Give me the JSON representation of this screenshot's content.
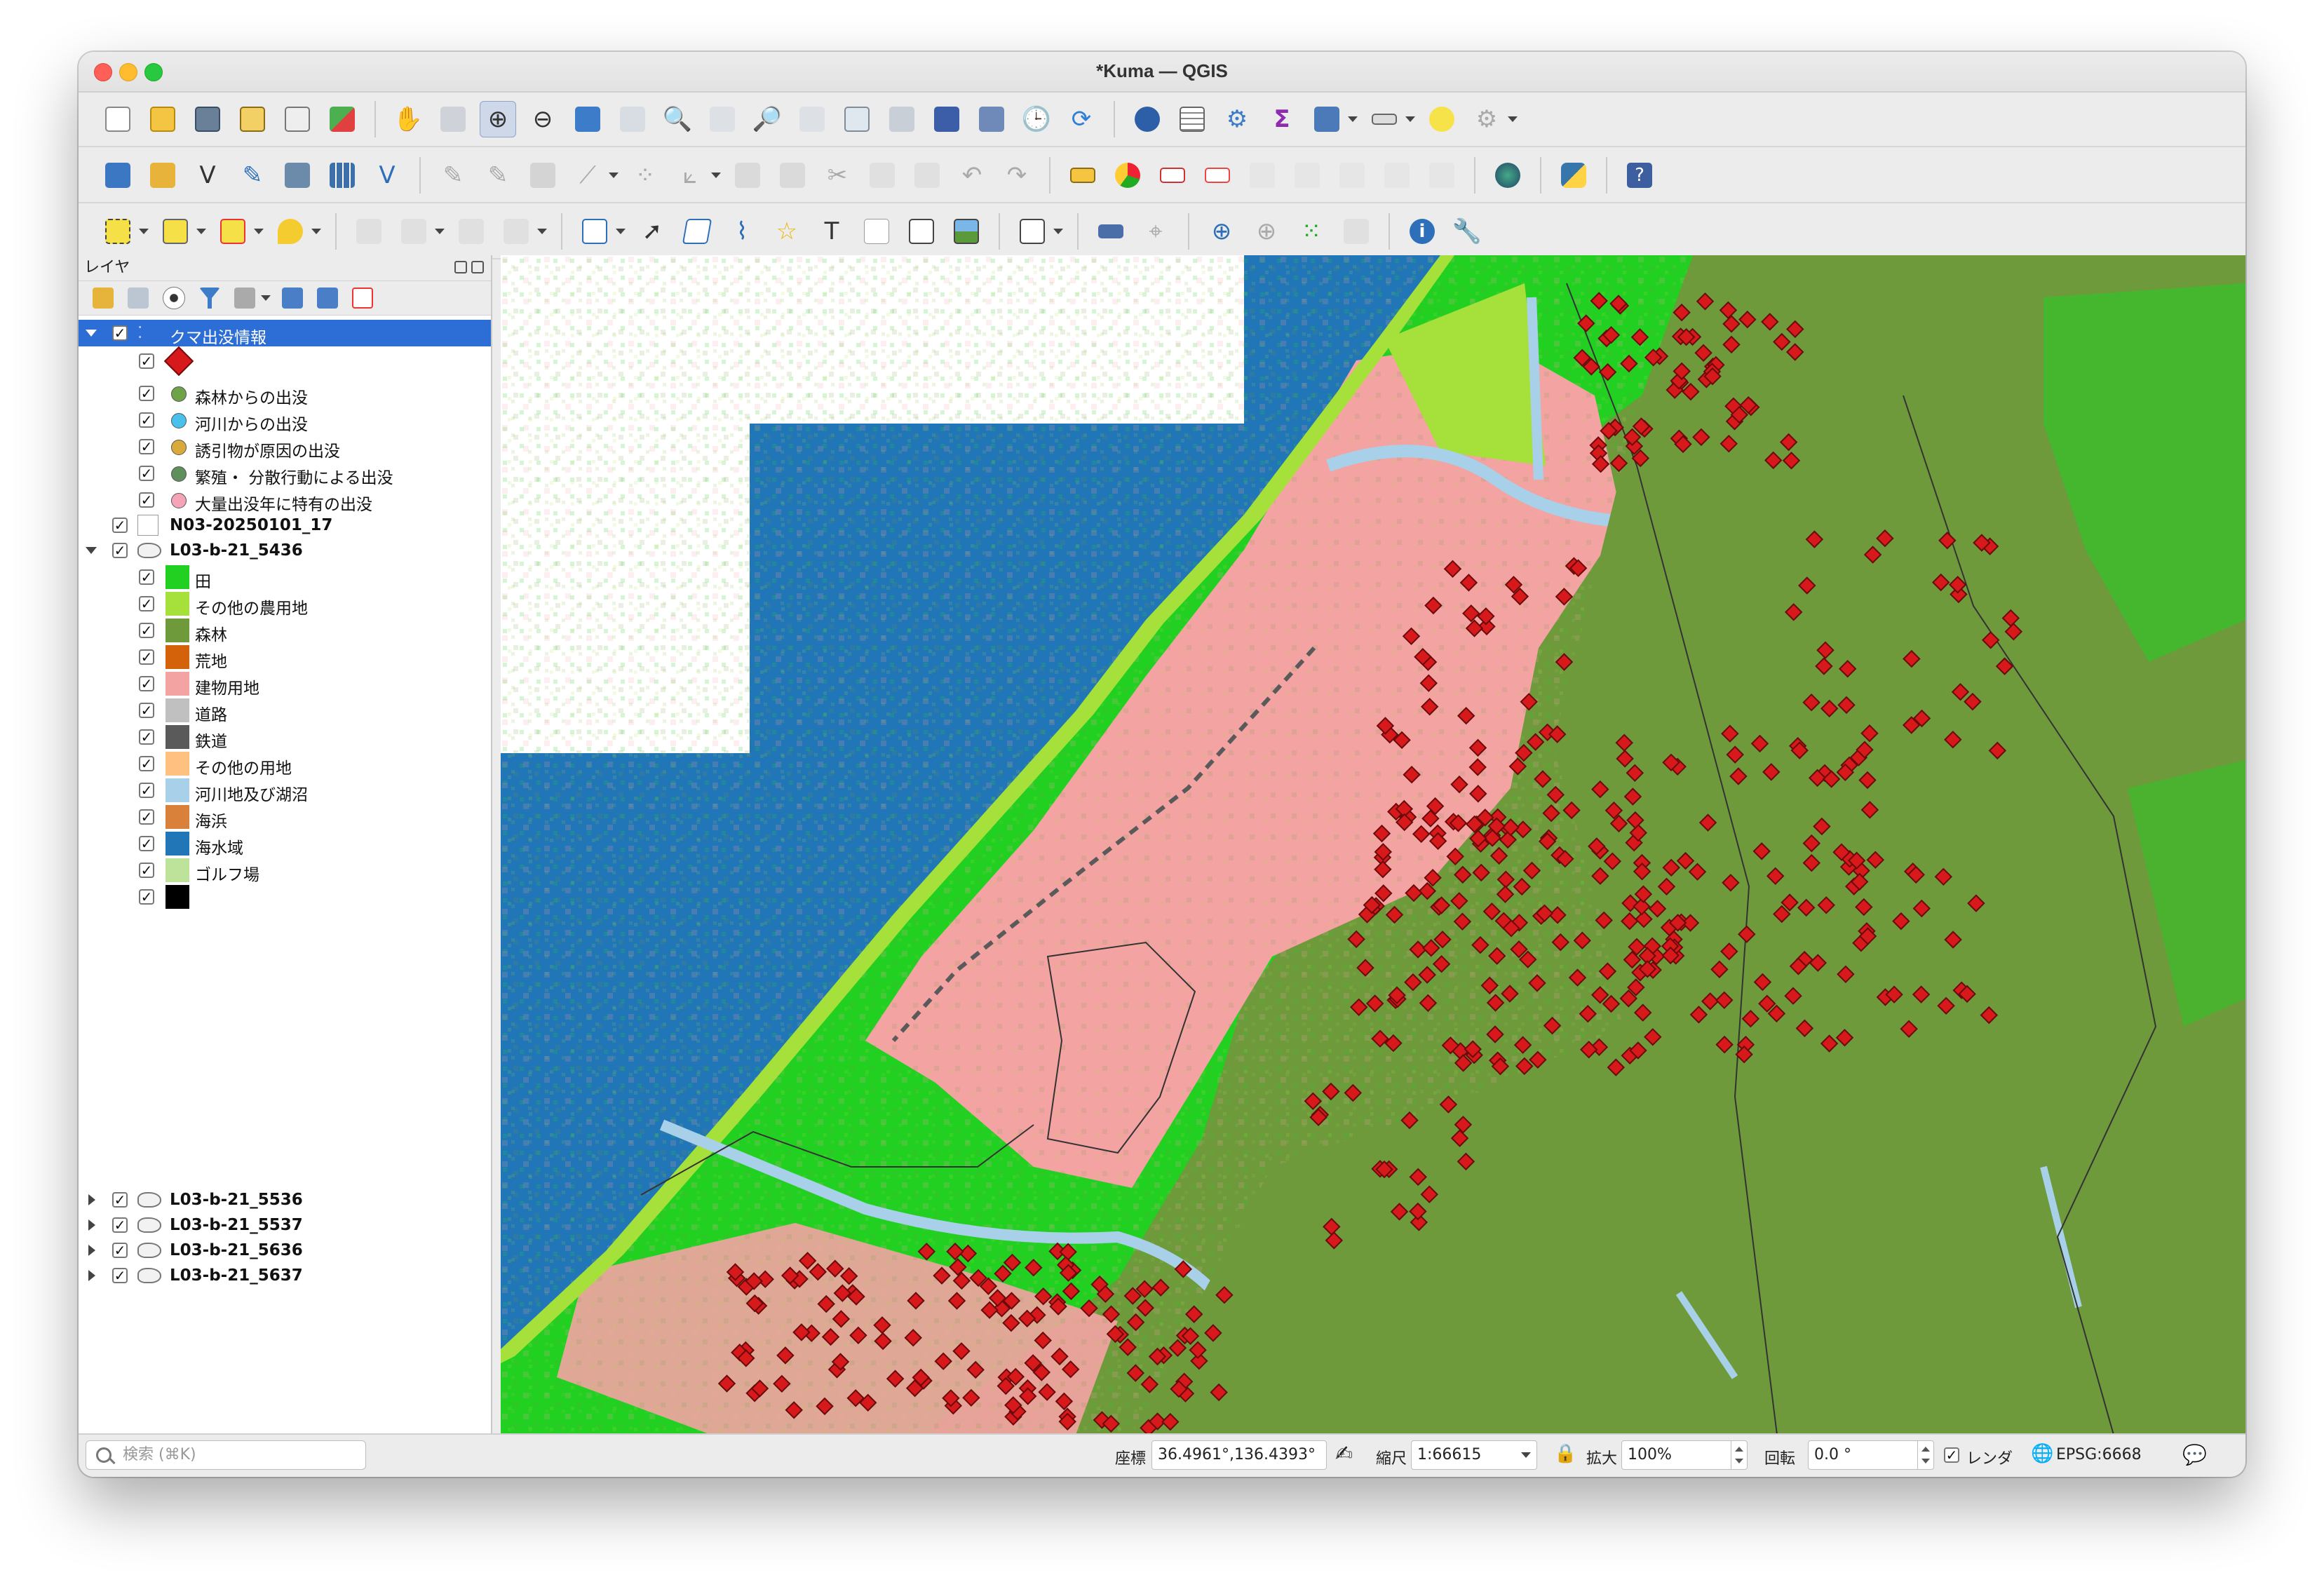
{
  "window": {
    "title": "*Kuma — QGIS"
  },
  "layer_panel": {
    "title": "レイヤ",
    "layers": [
      {
        "name": "クマ出没情報",
        "type": "point-group",
        "selected": true,
        "checked": true,
        "legend": [
          {
            "label": "",
            "symbol": "red-diamond",
            "color": "#d7191c"
          },
          {
            "label": "森林からの出没",
            "symbol": "circle",
            "color": "#6fa34a"
          },
          {
            "label": "河川からの出没",
            "symbol": "circle",
            "color": "#49c1ec"
          },
          {
            "label": "誘引物が原因の出没",
            "symbol": "circle",
            "color": "#d9aa3b"
          },
          {
            "label": "繁殖・ 分散行動による出没",
            "symbol": "circle",
            "color": "#5f8f5a"
          },
          {
            "label": "大量出没年に特有の出没",
            "symbol": "circle",
            "color": "#f5a3b6"
          }
        ]
      },
      {
        "name": "N03-20250101_17",
        "type": "polygon",
        "checked": true
      },
      {
        "name": "L03-b-21_5436",
        "type": "raster",
        "checked": true,
        "legend": [
          {
            "label": "田",
            "color": "#22d022"
          },
          {
            "label": "その他の農用地",
            "color": "#a6e03a"
          },
          {
            "label": "森林",
            "color": "#6e9a3c"
          },
          {
            "label": "荒地",
            "color": "#d4620a"
          },
          {
            "label": "建物用地",
            "color": "#f4a3a3"
          },
          {
            "label": "道路",
            "color": "#c0c0c0"
          },
          {
            "label": "鉄道",
            "color": "#5a5a5a"
          },
          {
            "label": "その他の用地",
            "color": "#ffc080"
          },
          {
            "label": "河川地及び湖沼",
            "color": "#a8d0e8"
          },
          {
            "label": "海浜",
            "color": "#d9803a"
          },
          {
            "label": "海水域",
            "color": "#2176b8"
          },
          {
            "label": "ゴルフ場",
            "color": "#bde39a"
          },
          {
            "label": "",
            "color": "#000000"
          }
        ]
      },
      {
        "name": "L03-b-21_5536",
        "type": "raster",
        "checked": true
      },
      {
        "name": "L03-b-21_5537",
        "type": "raster",
        "checked": true
      },
      {
        "name": "L03-b-21_5636",
        "type": "raster",
        "checked": true
      },
      {
        "name": "L03-b-21_5637",
        "type": "raster",
        "checked": true
      }
    ]
  },
  "status_bar": {
    "search_placeholder": "検索 (⌘K)",
    "coordinate_label": "座標",
    "coordinate_value": "36.4961°,136.4393°",
    "scale_label": "縮尺",
    "scale_value": "1:66615",
    "magnifier_label": "拡大",
    "magnifier_value": "100%",
    "rotation_label": "回転",
    "rotation_value": "0.0 °",
    "render_label": "レンダ",
    "render_checked": true,
    "crs": "EPSG:6668"
  },
  "colors": {
    "sea": "#2176b8",
    "forest": "#6e9a3c",
    "paddy": "#22d022",
    "urban": "#f4a3a3",
    "bear_marker": "#d7191c",
    "selection": "#2c6ed6"
  }
}
